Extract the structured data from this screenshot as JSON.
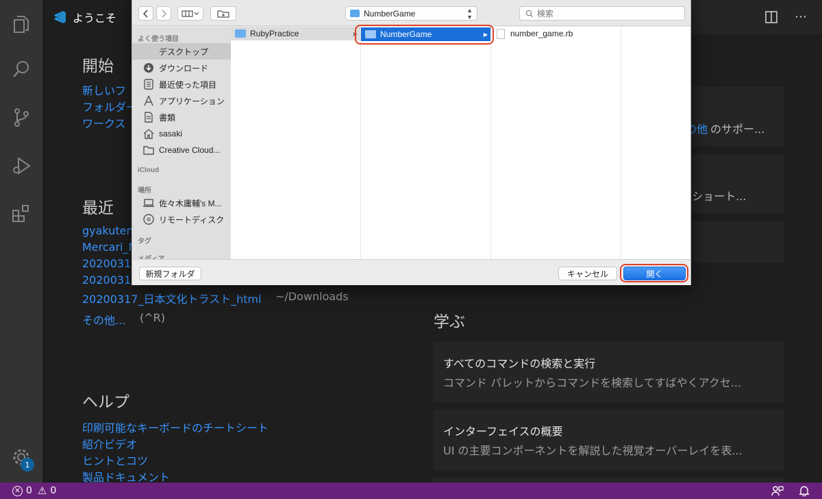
{
  "tab": {
    "title": "ようこそ"
  },
  "editor": {
    "start": {
      "heading": "開始",
      "links": [
        "新しいフ",
        "フォルダー",
        "ワークス"
      ]
    },
    "recent": {
      "heading": "最近",
      "items": [
        {
          "name": "gyakuten",
          "path": ""
        },
        {
          "name": "Mercari_N",
          "path": ""
        },
        {
          "name": "2020031",
          "path": ""
        },
        {
          "name": "2020031",
          "path": ""
        },
        {
          "name": "20200317_日本文化トラスト_html",
          "path": "~/Downloads"
        }
      ],
      "more": "その他...",
      "more_shortcut": "(^R)"
    },
    "help": {
      "heading": "ヘルプ",
      "links": [
        "印刷可能なキーボードのチートシート",
        "紹介ビデオ",
        "ヒントとコツ",
        "製品ドキュメント"
      ]
    },
    "customize_cards": [
      {
        "title": "",
        "desc_link": "の他",
        "desc": "のサポー..."
      },
      {
        "title": "",
        "desc": "ド ショート..."
      },
      {
        "title": "",
        "desc": ""
      }
    ],
    "learn": {
      "heading": "学ぶ",
      "cards": [
        {
          "title": "すべてのコマンドの検索と実行",
          "desc": "コマンド パレットからコマンドを検索してすばやくアクセ..."
        },
        {
          "title": "インターフェイスの概要",
          "desc": "UI の主要コンポーネントを解説した視覚オーバーレイを表..."
        }
      ]
    }
  },
  "status": {
    "errors": "0",
    "warnings": "0"
  },
  "settings_badge": "1",
  "dialog": {
    "location": "NumberGame",
    "search_placeholder": "検索",
    "sidebar": {
      "favorites_heading": "よく使う項目",
      "favorites": [
        "デスクトップ",
        "ダウンロード",
        "最近使った項目",
        "アプリケーション",
        "書類",
        "sasaki",
        "Creative Cloud..."
      ],
      "icloud_heading": "iCloud",
      "locations_heading": "場所",
      "locations": [
        "佐々木庸輔's M...",
        "リモートディスク"
      ],
      "tags_heading": "タグ",
      "media_heading": "メディア"
    },
    "columns": {
      "col1": [
        "RubyPractice"
      ],
      "col2": [
        "NumberGame"
      ],
      "col3": [
        "number_game.rb"
      ]
    },
    "new_folder": "新規フォルダ",
    "cancel": "キャンセル",
    "open": "開く"
  }
}
